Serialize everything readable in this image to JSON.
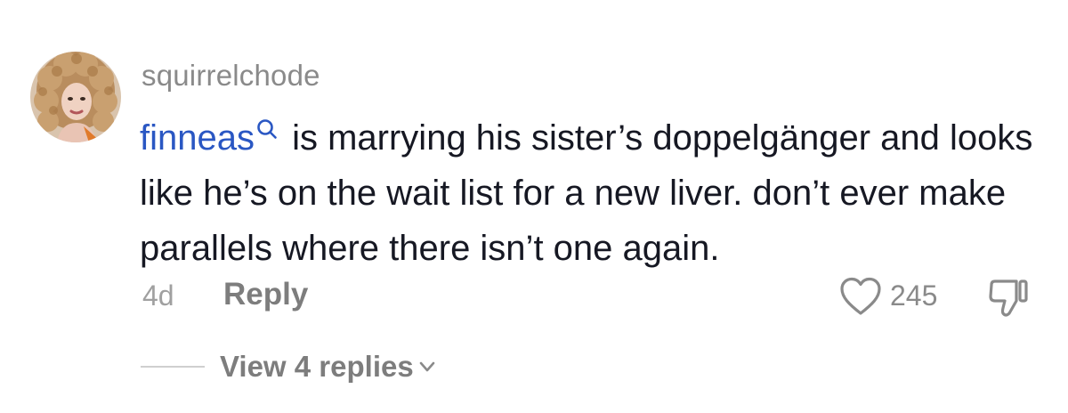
{
  "comment": {
    "username": "squirrelchode",
    "mention": "finneas",
    "text": " is marrying his sister’s doppelgänger and looks like he’s on the wait list for a new liver. don’t ever make parallels where there isn’t one again.",
    "age": "4d",
    "reply_label": "Reply",
    "like_count": "245",
    "view_replies_label": "View 4 replies"
  },
  "icons": {
    "mention_search": "search-icon",
    "like": "heart-icon",
    "dislike": "thumbs-down-icon",
    "expand": "chevron-down-icon"
  },
  "colors": {
    "mention": "#2a57c3",
    "text": "#161823",
    "muted": "#8a8a8a"
  }
}
